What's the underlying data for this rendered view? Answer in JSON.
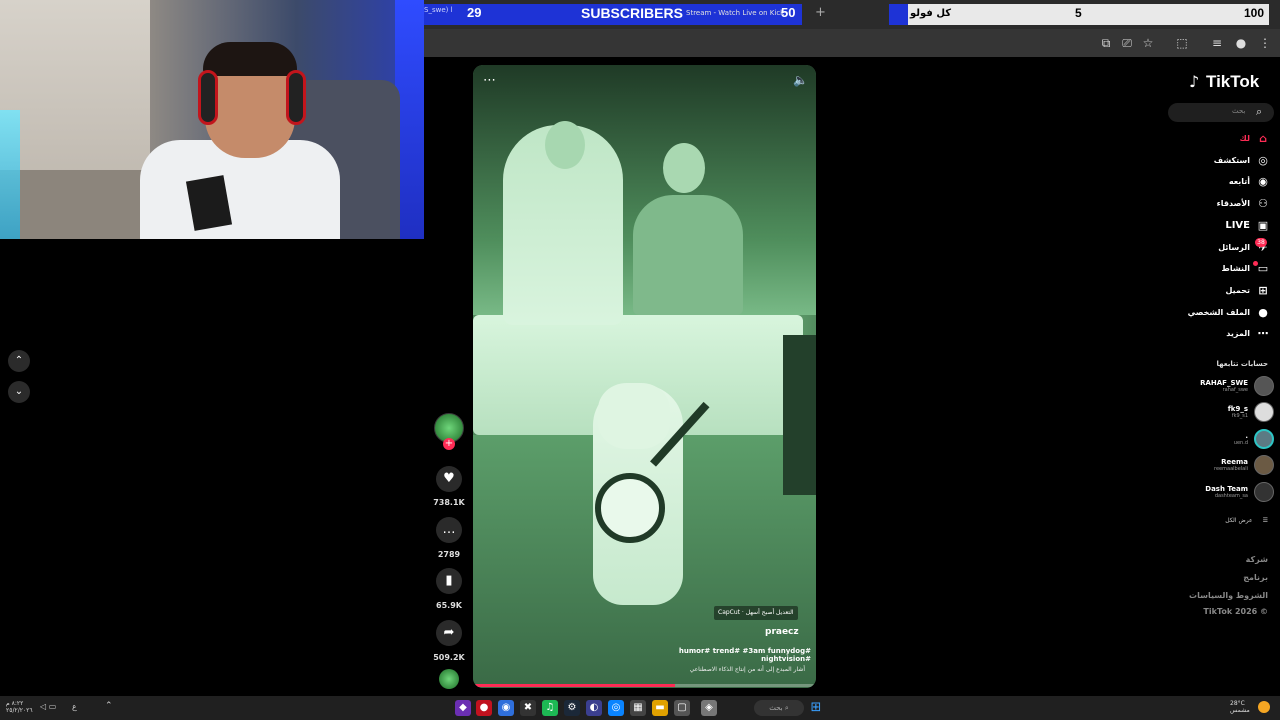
{
  "overlay": {
    "subs_left_text": "S_swe) l",
    "subs_count": "29",
    "subs_label": "SUBSCRIBERS",
    "browser_tab_title": "Stream - Watch Live on Kick",
    "subs_goal": "50",
    "new_tab": "+",
    "follow_label": "كل فولو",
    "follow_count": "5",
    "follow_goal": "100",
    "follow_progress": 0.05
  },
  "video": {
    "more_icon": "⋯",
    "sound_icon": "🔈",
    "capcut_label": "CapCut · التعديل أصبح أسهل",
    "author": "praecz",
    "hashtags": "humor# trend# #3am funnydog# nightvision#",
    "ai_note": "أشار المبدع إلى أنه من إنتاج الذكاء الاصطناعي",
    "progress": 0.59
  },
  "actions": {
    "follow_plus": "+",
    "like_count": "738.1K",
    "comment_count": "2789",
    "save_count": "65.9K",
    "share_count": "509.2K"
  },
  "nav_arrows": {
    "up": "⌃",
    "down": "⌄"
  },
  "sidebar": {
    "logo": "TikTok",
    "search_placeholder": "بحث",
    "items": [
      {
        "label": "لك",
        "icon": "home-icon",
        "active": true
      },
      {
        "label": "استكشف",
        "icon": "compass-icon"
      },
      {
        "label": "أتابعه",
        "icon": "following-icon"
      },
      {
        "label": "الأصدقاء",
        "icon": "friends-icon"
      },
      {
        "label": "LIVE",
        "icon": "live-icon"
      },
      {
        "label": "الرسائل",
        "icon": "messages-icon"
      },
      {
        "label": "النشاط",
        "icon": "activity-icon"
      },
      {
        "label": "تحميل",
        "icon": "upload-icon"
      },
      {
        "label": "الملف الشخصي",
        "icon": "profile-icon"
      },
      {
        "label": "المزيد",
        "icon": "more-icon"
      }
    ],
    "messages_badge": "38",
    "following_title": "حسابات تتابعها",
    "accounts": [
      {
        "name": "RAHAF_SWE",
        "handle": "rahaf_swe"
      },
      {
        "name": "fk9_s",
        "handle": "fk9_s1"
      },
      {
        "name": ".",
        "handle": "uen.d"
      },
      {
        "name": "Reema",
        "handle": "reemaalbelali"
      },
      {
        "name": "Dash Team",
        "handle": "dashteam_sa"
      }
    ],
    "see_all": "عرض الكل",
    "footer": [
      "شركة",
      "برنامج",
      "الشروط والسياسات",
      "TikTok 2026 ©"
    ]
  },
  "taskbar": {
    "time": "٨:٢٢ م",
    "date": "٢٥/٢/٢٠٢٦",
    "lang": "ع",
    "search_label": "بحث",
    "weather": "28°C",
    "weather_desc": "مشمس"
  }
}
